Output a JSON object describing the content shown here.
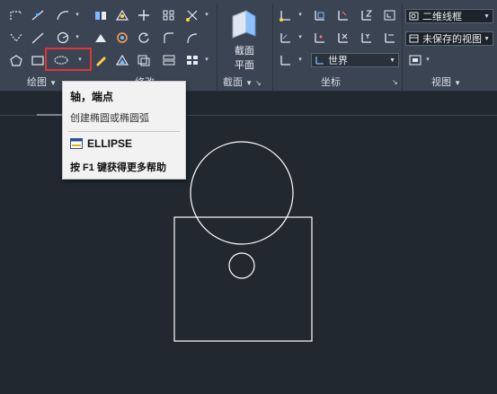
{
  "ribbon": {
    "panels": {
      "draw": "绘图",
      "modify": "修改",
      "section": "截面",
      "coordinates": "坐标",
      "view": "视图"
    },
    "section_button": {
      "line1": "截面",
      "line2": "平面"
    },
    "ucs_combo": "世界",
    "visual_style_combo": "二维线框",
    "named_view_combo": "未保存的视图"
  },
  "tooltip": {
    "title": "轴，端点",
    "description": "创建椭圆或椭圆弧",
    "command": "ELLIPSE",
    "help": "按 F1 键获得更多帮助"
  },
  "colors": {
    "ribbon_bg": "#3b4453",
    "canvas_bg": "#212830",
    "highlight": "#e03535",
    "tooltip_bg": "#f2f2f2",
    "drawing_stroke": "#ffffff"
  }
}
